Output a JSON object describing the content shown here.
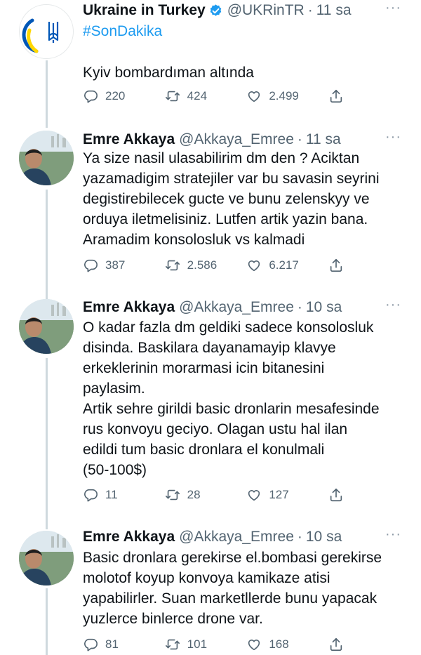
{
  "tweets": [
    {
      "name": "Ukraine in Turkey",
      "handle": "@UKRinTR",
      "separator": "·",
      "time": "11 sa",
      "hashtag": "#SonDakika",
      "text": "Kyiv bombardıman altında",
      "replies": "220",
      "retweets": "424",
      "likes": "2.499",
      "more": "···"
    },
    {
      "name": "Emre Akkaya",
      "handle": "@Akkaya_Emree",
      "separator": "·",
      "time": "11 sa",
      "text": "Ya size nasil ulasabilirim dm den ? Aciktan\nyazamadigim stratejiler var bu savasin seyrini\ndegistirebilecek gucte ve bunu zelenskyy ve\norduya iletmelisiniz. Lutfen artik yazin bana.\nAramadim konsolosluk vs kalmadi",
      "replies": "387",
      "retweets": "2.586",
      "likes": "6.217",
      "more": "···"
    },
    {
      "name": "Emre Akkaya",
      "handle": "@Akkaya_Emree",
      "separator": "·",
      "time": "10 sa",
      "text": "O kadar fazla dm geldiki sadece konsolosluk\ndisinda. Baskilara dayanamayip klavye\nerkeklerinin morarmasi icin bitanesini\npaylasim.\nArtik sehre girildi basic dronlarin mesafesinde\nrus konvoyu geciyo. Olagan ustu hal ilan\nedildi tum basic dronlara el konulmali\n(50-100$)",
      "replies": "11",
      "retweets": "28",
      "likes": "127",
      "more": "···"
    },
    {
      "name": "Emre Akkaya",
      "handle": "@Akkaya_Emree",
      "separator": "·",
      "time": "10 sa",
      "text": "Basic dronlara gerekirse el.bombasi gerekirse\nmolotof koyup konvoya kamikaze atisi\nyapabilirler. Suan marketllerde bunu yapacak\nyuzlerce binlerce drone var.",
      "replies": "81",
      "retweets": "101",
      "likes": "168",
      "more": "···"
    }
  ],
  "colors": {
    "accent": "#1d9bf0",
    "ukraine_blue": "#0057b7",
    "ukraine_yellow": "#ffd700",
    "thread_line": "#cfd9de",
    "secondary_text": "#536471"
  },
  "icons": [
    "reply-icon",
    "retweet-icon",
    "like-icon",
    "share-icon",
    "verified-badge-icon",
    "more-icon"
  ]
}
